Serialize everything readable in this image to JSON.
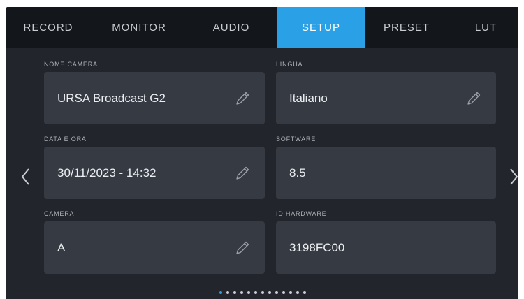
{
  "tabs": [
    {
      "label": "RECORD",
      "active": false
    },
    {
      "label": "MONITOR",
      "active": false
    },
    {
      "label": "AUDIO",
      "active": false
    },
    {
      "label": "SETUP",
      "active": true
    },
    {
      "label": "PRESET",
      "active": false
    },
    {
      "label": "LUT",
      "active": false
    }
  ],
  "fields": {
    "camera_name": {
      "label": "NOME CAMERA",
      "value": "URSA Broadcast G2",
      "editable": true
    },
    "language": {
      "label": "LINGUA",
      "value": "Italiano",
      "editable": true
    },
    "date_time": {
      "label": "DATA E ORA",
      "value": "30/11/2023 - 14:32",
      "editable": true
    },
    "software": {
      "label": "SOFTWARE",
      "value": "8.5",
      "editable": false
    },
    "camera_id": {
      "label": "CAMERA",
      "value": "A",
      "editable": true
    },
    "hardware_id": {
      "label": "ID HARDWARE",
      "value": "3198FC00",
      "editable": false
    }
  },
  "navigation": {
    "prev_icon": "chevron-left-icon",
    "next_icon": "chevron-right-icon"
  },
  "pagination": {
    "total_pages": 13,
    "current_page": 1
  },
  "colors": {
    "accent": "#2aa1e6",
    "background": "#22262c",
    "tabbar": "#13161a",
    "field": "#353a43"
  }
}
